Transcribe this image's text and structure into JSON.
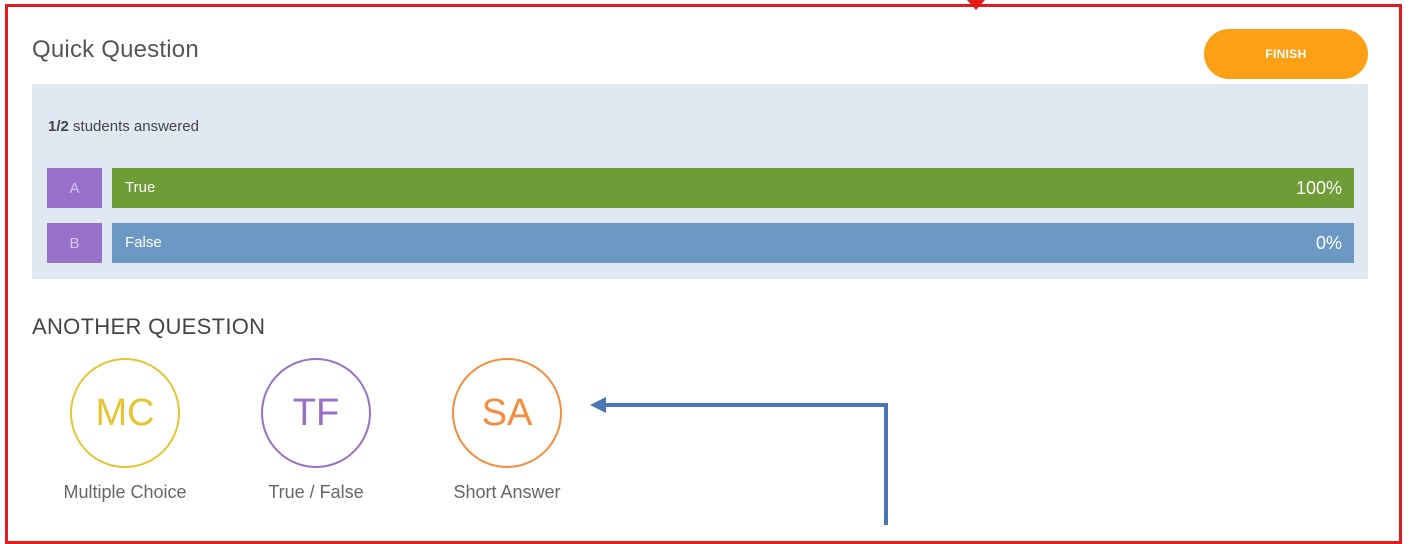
{
  "header": {
    "title": "Quick Question",
    "finish_label": "FINISH"
  },
  "results": {
    "answered_count": "1/2",
    "answered_suffix": " students answered",
    "answers": [
      {
        "letter": "A",
        "label": "True",
        "percent_text": "100%",
        "percent": 100,
        "color": "#6e9c36"
      },
      {
        "letter": "B",
        "label": "False",
        "percent_text": "0%",
        "percent": 0,
        "color": "#6c99c3"
      }
    ]
  },
  "another": {
    "heading": "ANOTHER QUESTION",
    "types": [
      {
        "abbr": "MC",
        "label": "Multiple Choice",
        "color": "#e6c532"
      },
      {
        "abbr": "TF",
        "label": "True / False",
        "color": "#9670c9"
      },
      {
        "abbr": "SA",
        "label": "Short Answer",
        "color": "#f58d3d"
      }
    ]
  },
  "colors": {
    "accent": "#fca016",
    "panel_bg": "#e0e9f1",
    "annotation_frame": "#e31b1b",
    "annotation_arrow": "#4a76b5"
  }
}
